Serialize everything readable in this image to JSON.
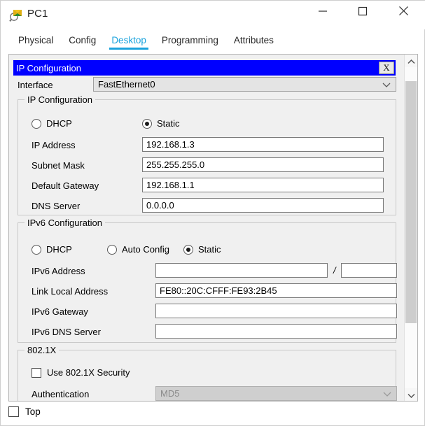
{
  "window": {
    "title": "PC1",
    "app_icon": "packet-tracer-pc-icon",
    "controls": {
      "minimize": "—",
      "maximize": "□",
      "close": "✕"
    }
  },
  "tabs": [
    {
      "label": "Physical",
      "active": false
    },
    {
      "label": "Config",
      "active": false
    },
    {
      "label": "Desktop",
      "active": true
    },
    {
      "label": "Programming",
      "active": false
    },
    {
      "label": "Attributes",
      "active": false
    }
  ],
  "dialog": {
    "caption": "IP Configuration",
    "close_label": "X",
    "interface": {
      "label": "Interface",
      "value": "FastEthernet0"
    }
  },
  "ipv4": {
    "group_title": "IP Configuration",
    "mode_dhcp": "DHCP",
    "mode_static": "Static",
    "selected_mode": "Static",
    "fields": [
      {
        "label": "IP Address",
        "value": "192.168.1.3"
      },
      {
        "label": "Subnet Mask",
        "value": "255.255.255.0"
      },
      {
        "label": "Default Gateway",
        "value": "192.168.1.1"
      },
      {
        "label": "DNS Server",
        "value": "0.0.0.0"
      }
    ]
  },
  "ipv6": {
    "group_title": "IPv6 Configuration",
    "mode_dhcp": "DHCP",
    "mode_auto": "Auto Config",
    "mode_static": "Static",
    "selected_mode": "Static",
    "address_label": "IPv6 Address",
    "address_value": "",
    "prefix_separator": "/",
    "prefix_value": "",
    "link_local_label": "Link Local Address",
    "link_local_value": "FE80::20C:CFFF:FE93:2B45",
    "gateway_label": "IPv6 Gateway",
    "gateway_value": "",
    "dns_label": "IPv6 DNS Server",
    "dns_value": ""
  },
  "dot1x": {
    "group_title": "802.1X",
    "use_security_label": "Use 802.1X Security",
    "use_security_checked": false,
    "authentication_label": "Authentication",
    "authentication_value": "MD5"
  },
  "footer": {
    "top_label": "Top",
    "top_checked": false
  },
  "colors": {
    "accent_tab": "#19a2dc",
    "dialog_caption": "#0000ff",
    "panel_bg": "#f0f0f0",
    "input_bg": "#ffffff"
  }
}
